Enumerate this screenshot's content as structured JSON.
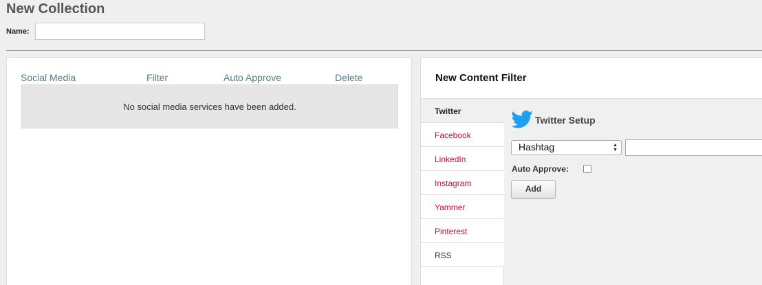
{
  "page": {
    "title": "New Collection"
  },
  "name_field": {
    "label": "Name:",
    "value": "",
    "placeholder": ""
  },
  "services_table": {
    "columns": [
      "Social Media",
      "Filter",
      "Auto Approve",
      "Delete"
    ],
    "empty_message": "No social media services have been added."
  },
  "content_filter": {
    "title": "New Content Filter",
    "tabs": [
      {
        "label": "Twitter",
        "active": true
      },
      {
        "label": "Facebook",
        "active": false
      },
      {
        "label": "LinkedIn",
        "active": false
      },
      {
        "label": "Instagram",
        "active": false
      },
      {
        "label": "Yammer",
        "active": false
      },
      {
        "label": "Pinterest",
        "active": false
      },
      {
        "label": "RSS",
        "active": false
      }
    ],
    "setup": {
      "icon": "twitter-bird-icon",
      "title": "Twitter Setup",
      "type_select": {
        "selected": "Hashtag"
      },
      "term_input": {
        "value": ""
      },
      "auto_approve_label": "Auto Approve:",
      "auto_approve_checked": false,
      "add_label": "Add"
    }
  },
  "colors": {
    "background": "#efefef",
    "link_teal": "#4c7f84",
    "tab_red": "#c8102e",
    "twitter_blue": "#1da1f2"
  }
}
